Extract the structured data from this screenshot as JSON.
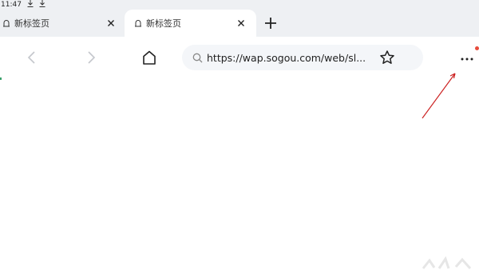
{
  "status_bar": {
    "time": "11:47",
    "download_icons": [
      "download-icon",
      "download-icon"
    ]
  },
  "tabs": [
    {
      "label": "新标签页",
      "active": false,
      "icon": "tab-page-icon",
      "close_icon": "close-icon"
    },
    {
      "label": "新标签页",
      "active": true,
      "icon": "tab-page-icon",
      "close_icon": "close-icon"
    }
  ],
  "new_tab_icon": "plus-icon",
  "toolbar": {
    "back_icon": "chevron-left-icon",
    "forward_icon": "chevron-right-icon",
    "home_icon": "home-icon",
    "address": "https://wap.sogou.com/web/sl...",
    "address_icon": "search-icon",
    "bookmark_icon": "star-icon",
    "menu_icon": "more-dots-icon",
    "notification_dot_color": "#e74c3c"
  },
  "annotation_arrow_color": "#cc2222"
}
